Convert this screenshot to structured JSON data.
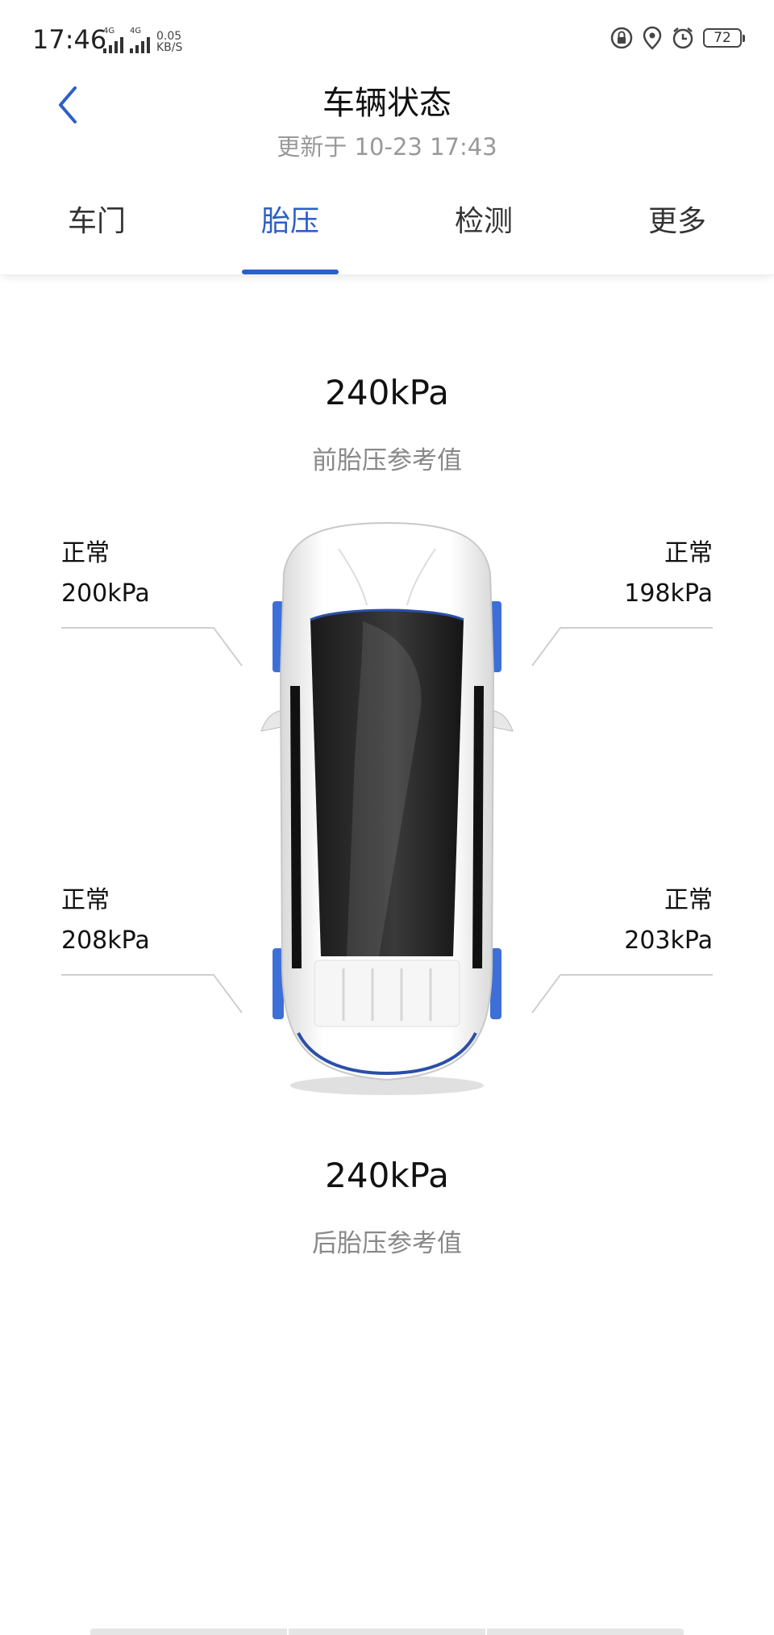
{
  "status_bar": {
    "time": "17:46",
    "network_1": "4G",
    "network_2": "4G",
    "speed_value": "0.05",
    "speed_unit": "KB/S",
    "battery": "72"
  },
  "header": {
    "title": "车辆状态",
    "updated": "更新于 10-23 17:43"
  },
  "tabs": [
    {
      "label": "车门"
    },
    {
      "label": "胎压"
    },
    {
      "label": "检测"
    },
    {
      "label": "更多"
    }
  ],
  "front_reference": {
    "value": "240kPa",
    "label": "前胎压参考值"
  },
  "rear_reference": {
    "value": "240kPa",
    "label": "后胎压参考值"
  },
  "tires": {
    "front_left": {
      "status": "正常",
      "pressure": "200kPa"
    },
    "front_right": {
      "status": "正常",
      "pressure": "198kPa"
    },
    "rear_left": {
      "status": "正常",
      "pressure": "208kPa"
    },
    "rear_right": {
      "status": "正常",
      "pressure": "203kPa"
    }
  },
  "colors": {
    "accent": "#2b5fc9",
    "secondary_text": "#999999",
    "tire_highlight": "#3d6fd8"
  }
}
